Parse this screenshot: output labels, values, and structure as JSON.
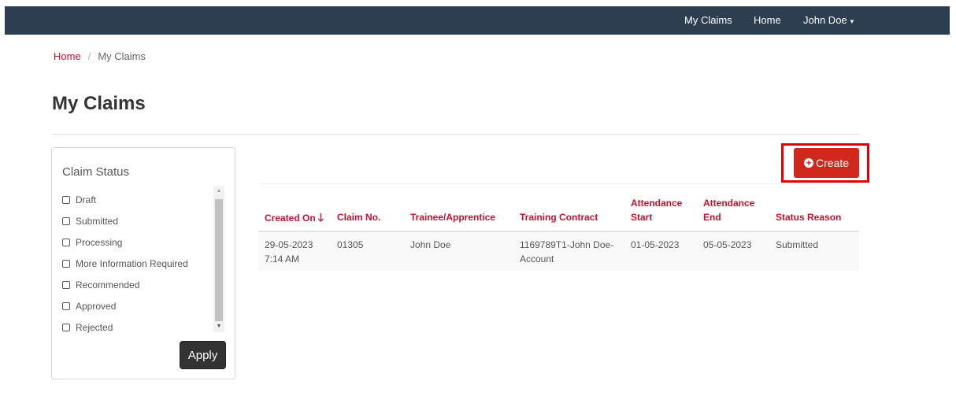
{
  "navbar": {
    "items": [
      {
        "label": "My Claims"
      },
      {
        "label": "Home"
      },
      {
        "label": "John Doe",
        "caret": "▾"
      }
    ]
  },
  "breadcrumb": {
    "home": "Home",
    "separator": "/",
    "current": "My Claims"
  },
  "page_title": "My Claims",
  "filter": {
    "title": "Claim Status",
    "options": [
      "Draft",
      "Submitted",
      "Processing",
      "More Information Required",
      "Recommended",
      "Approved",
      "Rejected"
    ],
    "apply_label": "Apply"
  },
  "create_button": {
    "label": "Create",
    "icon": "plus-circle-icon"
  },
  "table": {
    "columns": [
      {
        "label": "Created On",
        "sort": "descending"
      },
      {
        "label": "Claim No."
      },
      {
        "label": "Trainee/Apprentice"
      },
      {
        "label": "Training Contract"
      },
      {
        "label_line1": "Attendance",
        "label_line2": "Start"
      },
      {
        "label_line1": "Attendance",
        "label_line2": "End"
      },
      {
        "label": "Status Reason"
      }
    ],
    "rows": [
      {
        "created_on_date": "29-05-2023",
        "created_on_time": "7:14 AM",
        "claim_no": "01305",
        "trainee": "John Doe",
        "contract_line1": "1169789T1-John Doe-",
        "contract_line2": "Account",
        "attendance_start": "01-05-2023",
        "attendance_end": "05-05-2023",
        "status_reason": "Submitted"
      }
    ]
  },
  "colors": {
    "navbar": "#2c3e50",
    "accent_red": "#c8102e",
    "create_button": "#d0281c",
    "highlight": "#e00000"
  }
}
